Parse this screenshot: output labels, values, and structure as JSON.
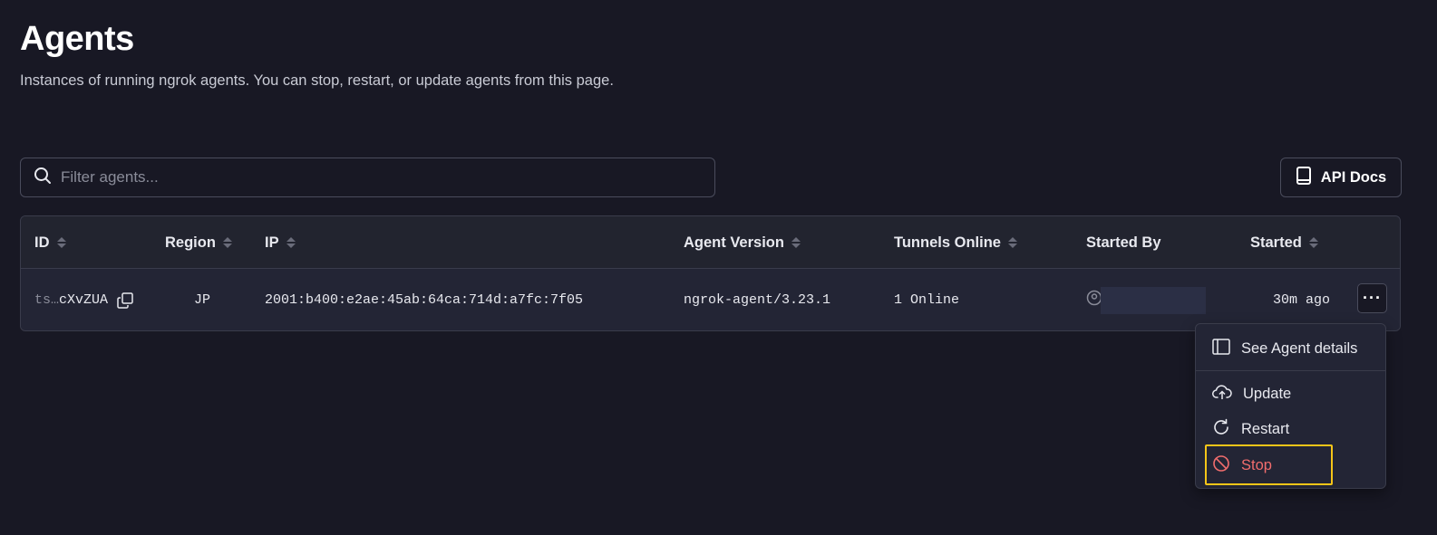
{
  "page": {
    "title": "Agents",
    "subtitle": "Instances of running ngrok agents. You can stop, restart, or update agents from this page."
  },
  "filter": {
    "placeholder": "Filter agents..."
  },
  "api_docs": {
    "label": "API Docs",
    "icon": "book-icon"
  },
  "table": {
    "columns": [
      {
        "key": "id",
        "label": "ID",
        "sortable": true
      },
      {
        "key": "region",
        "label": "Region",
        "sortable": true
      },
      {
        "key": "ip",
        "label": "IP",
        "sortable": true
      },
      {
        "key": "agent_version",
        "label": "Agent Version",
        "sortable": true
      },
      {
        "key": "tunnels_online",
        "label": "Tunnels Online",
        "sortable": true
      },
      {
        "key": "started_by",
        "label": "Started By",
        "sortable": false
      },
      {
        "key": "started",
        "label": "Started",
        "sortable": true
      }
    ],
    "rows": [
      {
        "id_prefix": "ts…",
        "id_suffix": "cXvZUA",
        "region": "JP",
        "ip": "2001:b400:e2ae:45ab:64ca:714d:a7fc:7f05",
        "agent_version": "ngrok-agent/3.23.1",
        "tunnels_online": "1 Online",
        "started": "30m ago"
      }
    ]
  },
  "row_menu": {
    "items": [
      {
        "label": "See Agent details",
        "icon": "sidebar-panel-icon"
      },
      {
        "label": "Update",
        "icon": "cloud-upload-icon"
      },
      {
        "label": "Restart",
        "icon": "restart-icon"
      },
      {
        "label": "Stop",
        "icon": "stop-icon",
        "color": "#f16d6d"
      }
    ]
  },
  "colors": {
    "background": "#181824",
    "surface": "#232535",
    "danger": "#f16d6d",
    "highlight": "#f5c518"
  }
}
